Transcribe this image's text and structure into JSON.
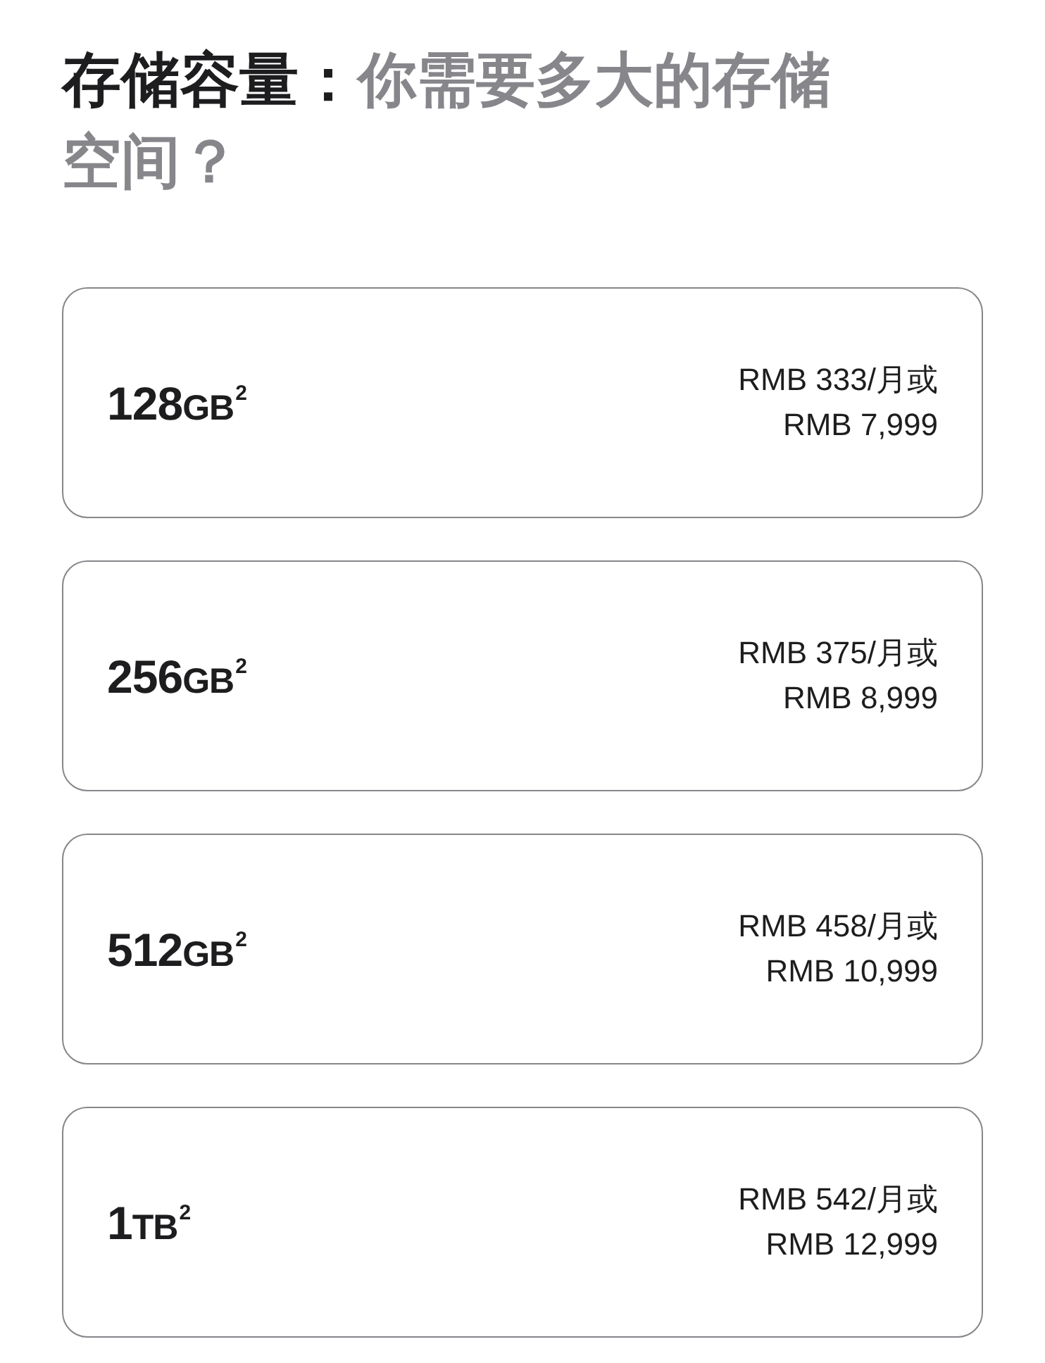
{
  "heading": {
    "label": "存储容量：",
    "question": "你需要多大的存储空间？"
  },
  "options": [
    {
      "size": "128",
      "unit": "GB",
      "note": "2",
      "monthly": "RMB 333/月或",
      "price": "RMB 7,999",
      "selected": false
    },
    {
      "size": "256",
      "unit": "GB",
      "note": "2",
      "monthly": "RMB 375/月或",
      "price": "RMB 8,999",
      "selected": false
    },
    {
      "size": "512",
      "unit": "GB",
      "note": "2",
      "monthly": "RMB 458/月或",
      "price": "RMB 10,999",
      "selected": false
    },
    {
      "size": "1",
      "unit": "TB",
      "note": "2",
      "monthly": "RMB 542/月或",
      "price": "RMB 12,999",
      "selected": false
    }
  ]
}
